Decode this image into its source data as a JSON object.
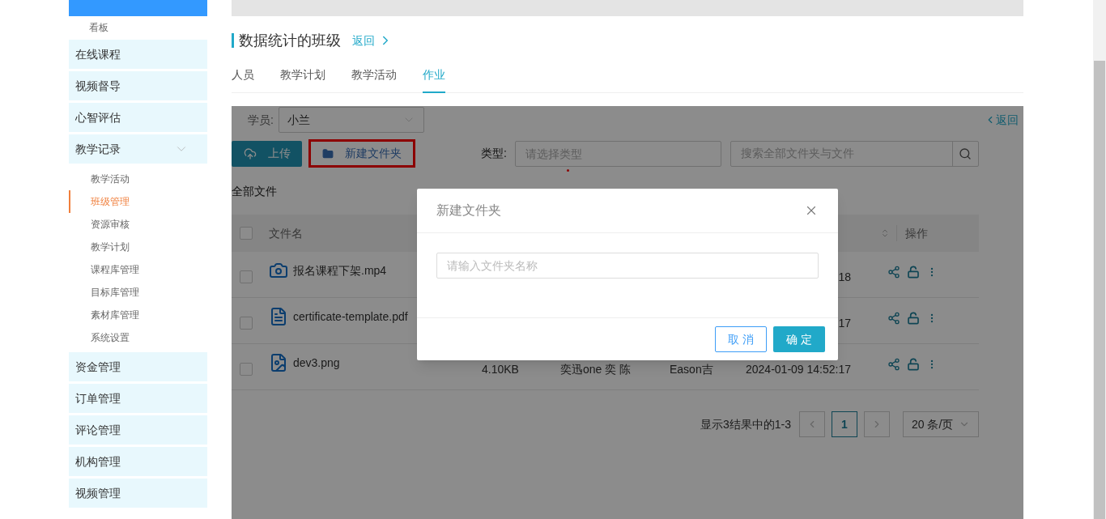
{
  "sidebar": {
    "items": [
      {
        "label": "看板",
        "kind": "sub",
        "selected": false
      },
      {
        "label": "在线课程",
        "kind": "group"
      },
      {
        "label": "视频督导",
        "kind": "group"
      },
      {
        "label": "心智评估",
        "kind": "group"
      },
      {
        "label": "教学记录",
        "kind": "group",
        "expanded": true,
        "children": [
          {
            "label": "教学活动",
            "selected": false
          },
          {
            "label": "班级管理",
            "selected": true
          },
          {
            "label": "资源审核",
            "selected": false
          },
          {
            "label": "教学计划",
            "selected": false
          },
          {
            "label": "课程库管理",
            "selected": false
          },
          {
            "label": "目标库管理",
            "selected": false
          },
          {
            "label": "素材库管理",
            "selected": false
          },
          {
            "label": "系统设置",
            "selected": false
          }
        ]
      },
      {
        "label": "资金管理",
        "kind": "group"
      },
      {
        "label": "订单管理",
        "kind": "group"
      },
      {
        "label": "评论管理",
        "kind": "group"
      },
      {
        "label": "机构管理",
        "kind": "group"
      },
      {
        "label": "视频管理",
        "kind": "group"
      }
    ]
  },
  "page": {
    "title": "数据统计的班级",
    "back_link": "返回"
  },
  "tabs": [
    {
      "label": "人员",
      "selected": false
    },
    {
      "label": "教学计划",
      "selected": false
    },
    {
      "label": "教学活动",
      "selected": false
    },
    {
      "label": "作业",
      "selected": true
    }
  ],
  "toolbar": {
    "student_label": "学员:",
    "student_value": "小兰",
    "back": "返回",
    "upload": "上传",
    "new_folder": "新建文件夹",
    "type_label": "类型:",
    "type_placeholder": "请选择类型",
    "search_placeholder": "搜索全部文件夹与文件"
  },
  "breadcrumb": "全部文件",
  "table": {
    "columns": [
      "文件名",
      "操作"
    ],
    "all_checked": false,
    "rows": [
      {
        "kind": "video",
        "checked": false,
        "name": "报名课程下架.mp4",
        "time": "18"
      },
      {
        "kind": "pdf",
        "checked": false,
        "name": "certificate-template.pdf",
        "time": "17"
      },
      {
        "kind": "image",
        "checked": false,
        "name": "dev3.png",
        "size": "4.10KB",
        "uploader": "奕迅one 奕 陈",
        "owner": "Eason吉",
        "time": "2024-01-09 14:52:17"
      }
    ]
  },
  "pagination": {
    "summary": "显示3结果中的1-3",
    "page": "1",
    "page_size": "20 条/页"
  },
  "dialog": {
    "title": "新建文件夹",
    "placeholder": "请输入文件夹名称",
    "cancel": "取 消",
    "confirm": "确 定"
  }
}
